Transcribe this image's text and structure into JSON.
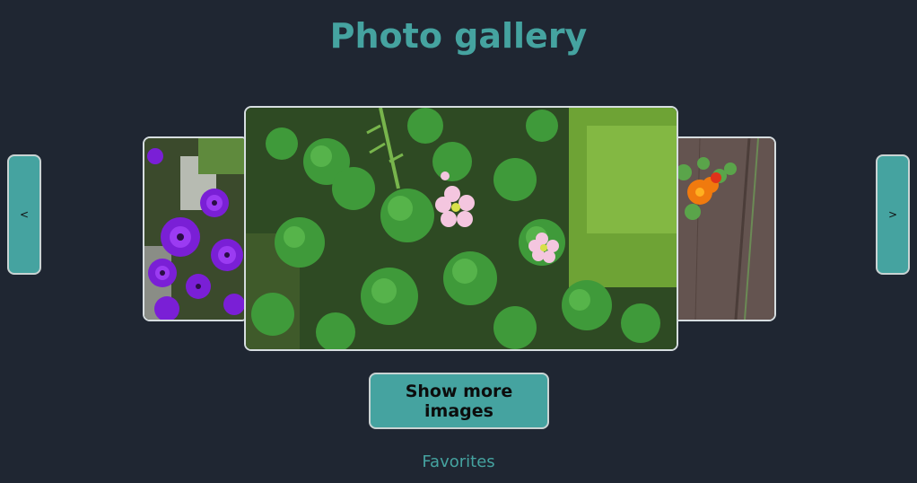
{
  "header": {
    "title": "Photo gallery"
  },
  "carousel": {
    "prev_label": "<",
    "next_label": ">",
    "photos": [
      {
        "subject": "purple-flowers",
        "position": "left"
      },
      {
        "subject": "clover-with-pink-flowers",
        "position": "center"
      },
      {
        "subject": "orange-nasturtium-on-wood-fence",
        "position": "right"
      }
    ]
  },
  "actions": {
    "show_more_label": "Show more images"
  },
  "footer": {
    "favorites_label": "Favorites"
  },
  "colors": {
    "background": "#1f2632",
    "accent": "#45a3a0",
    "border": "#c9d3d3"
  }
}
